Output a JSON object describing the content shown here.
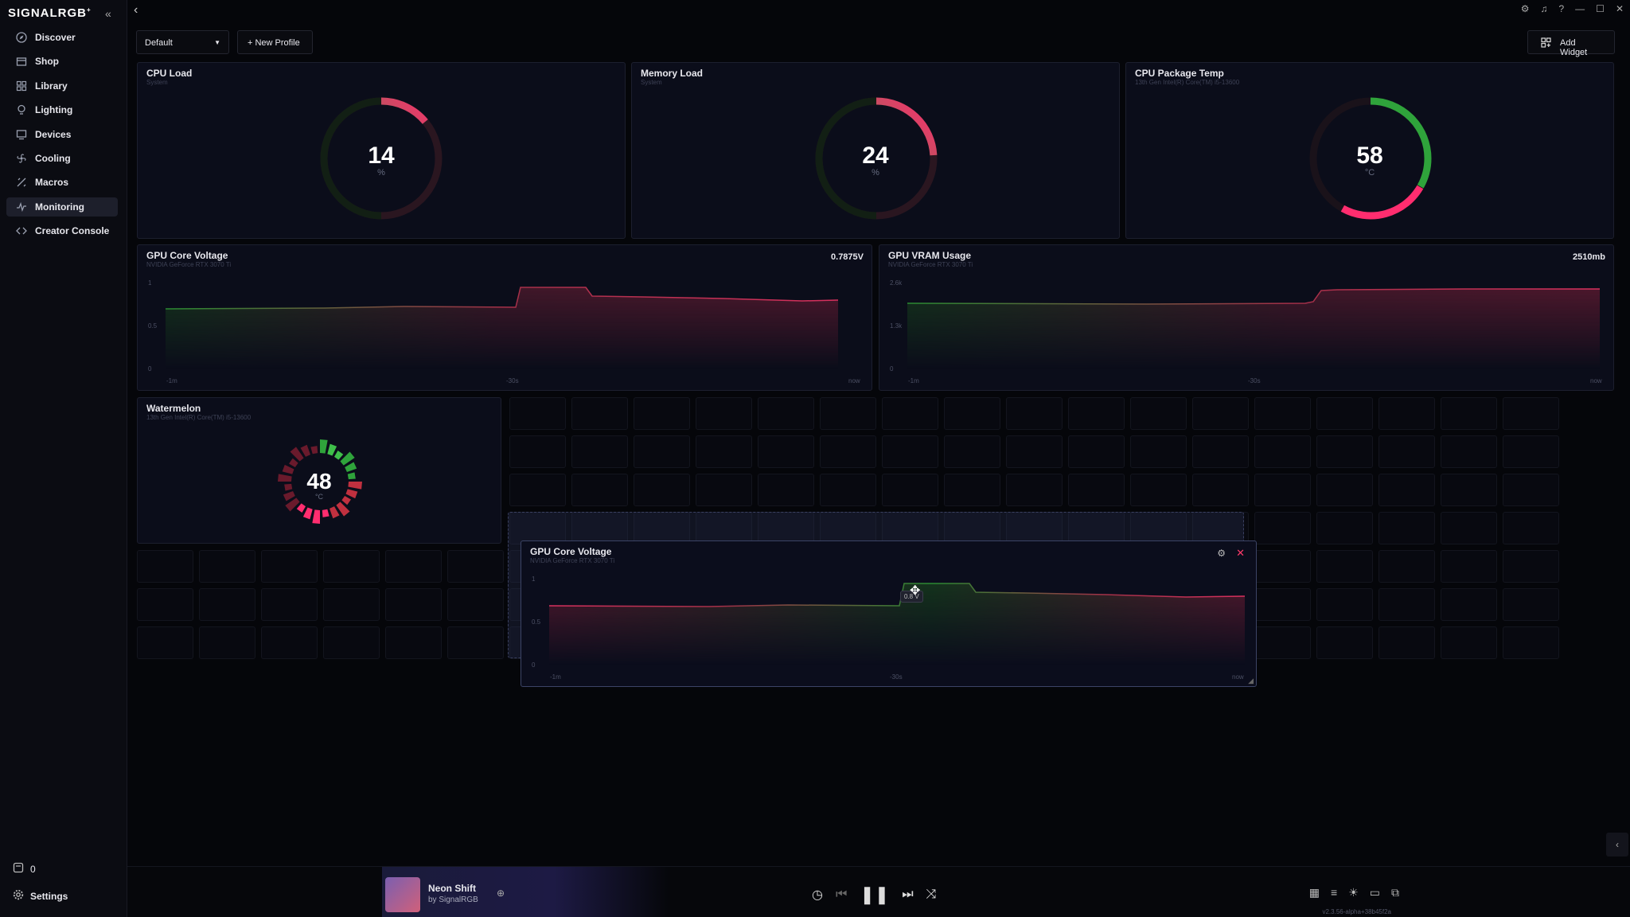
{
  "app": {
    "logo": "SIGNALRGB",
    "logo_mark": "+",
    "collapse_icon": "chevrons-left-icon"
  },
  "sidebar": {
    "items": [
      {
        "label": "Discover",
        "icon": "compass-icon"
      },
      {
        "label": "Shop",
        "icon": "shop-icon"
      },
      {
        "label": "Library",
        "icon": "grid-icon"
      },
      {
        "label": "Lighting",
        "icon": "bulb-icon"
      },
      {
        "label": "Devices",
        "icon": "monitor-icon"
      },
      {
        "label": "Cooling",
        "icon": "fan-icon"
      },
      {
        "label": "Macros",
        "icon": "macro-icon"
      },
      {
        "label": "Monitoring",
        "icon": "pulse-icon",
        "active": true
      },
      {
        "label": "Creator Console",
        "icon": "code-icon"
      }
    ],
    "count": "0",
    "settings": "Settings"
  },
  "toolbar": {
    "profile": "Default",
    "new_profile": "New Profile",
    "add_widget": "Add Widget"
  },
  "widgets": {
    "cpu_load": {
      "title": "CPU Load",
      "sub": "System",
      "value": "14",
      "unit": "%",
      "fraction": 0.14
    },
    "memory_load": {
      "title": "Memory Load",
      "sub": "System",
      "value": "24",
      "unit": "%",
      "fraction": 0.24
    },
    "cpu_temp": {
      "title": "CPU Package Temp",
      "sub": "13th Gen Intel(R) Core(TM) i5-13600",
      "value": "58",
      "unit": "°C",
      "fraction": 0.58
    },
    "gpu_voltage": {
      "title": "GPU Core Voltage",
      "sub": "NVIDIA GeForce RTX 3070 Ti",
      "value": "0.7875V",
      "y_ticks": [
        "1",
        "0.5",
        "0"
      ],
      "x_ticks": [
        "-1m",
        "-30s",
        "now"
      ]
    },
    "gpu_vram": {
      "title": "GPU VRAM Usage",
      "sub": "NVIDIA GeForce RTX 3070 Ti",
      "value": "2510mb",
      "y_ticks": [
        "2.6k",
        "1.3k",
        "0"
      ],
      "x_ticks": [
        "-1m",
        "-30s",
        "now"
      ]
    },
    "watermelon": {
      "title": "Watermelon",
      "sub": "13th Gen Intel(R) Core(TM) i5-13600",
      "value": "48",
      "unit": "°C"
    },
    "dragging": {
      "title": "GPU Core Voltage",
      "sub": "NVIDIA GeForce RTX 3070 Ti",
      "tooltip": "0.8 V",
      "y_ticks": [
        "1",
        "0.5",
        "0"
      ],
      "x_ticks": [
        "-1m",
        "-30s",
        "now"
      ]
    }
  },
  "player": {
    "track": "Neon Shift",
    "by": "by SignalRGB",
    "version": "v2.3.56-alpha+38b45f2a"
  },
  "colors": {
    "accent_red": "#ff2d6f",
    "accent_green": "#2fa33b",
    "panel": "#0b0d1a"
  }
}
